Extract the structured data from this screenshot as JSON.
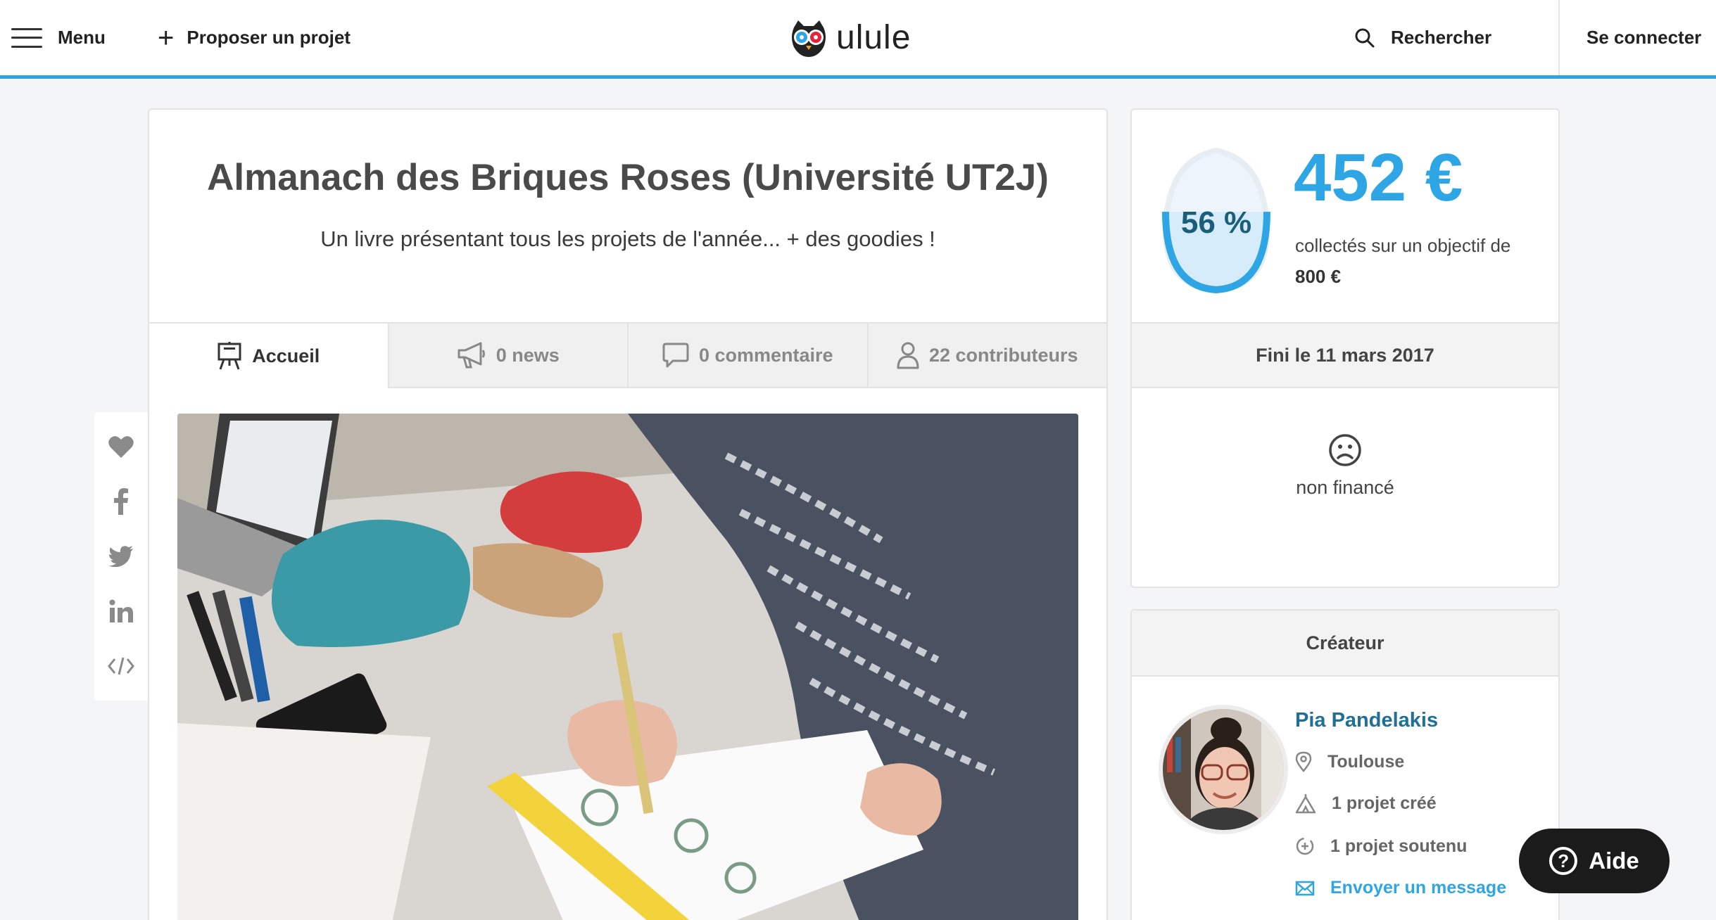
{
  "header": {
    "menu_label": "Menu",
    "propose_label": "Proposer un projet",
    "logo_text": "ulule",
    "search_label": "Rechercher",
    "login_label": "Se connecter"
  },
  "project": {
    "title": "Almanach des Briques Roses (Université UT2J)",
    "subtitle": "Un livre présentant tous les projets de l'année... + des goodies !"
  },
  "tabs": [
    {
      "label": "Accueil",
      "active": true
    },
    {
      "label": "0 news",
      "active": false
    },
    {
      "label": "0 commentaire",
      "active": false
    },
    {
      "label": "22 contributeurs",
      "active": false
    }
  ],
  "share_icons": [
    "heart-icon",
    "facebook-icon",
    "twitter-icon",
    "linkedin-icon",
    "embed-code-icon"
  ],
  "funding": {
    "percent_label": "56 %",
    "percent_fill": 0.56,
    "amount": "452 €",
    "goal_text": "collectés sur un objectif de",
    "goal_value": "800 €",
    "end_label": "Fini le 11 mars 2017",
    "status": "non financé"
  },
  "creator": {
    "header": "Créateur",
    "name": "Pia Pandelakis",
    "location": "Toulouse",
    "created": "1 projet créé",
    "backed": "1 projet soutenu",
    "message_label": "Envoyer un message"
  },
  "help_label": "Aide",
  "colors": {
    "accent": "#2ea6e5",
    "dark_blue": "#1f6f96",
    "help_bg": "#1b1b1b"
  }
}
